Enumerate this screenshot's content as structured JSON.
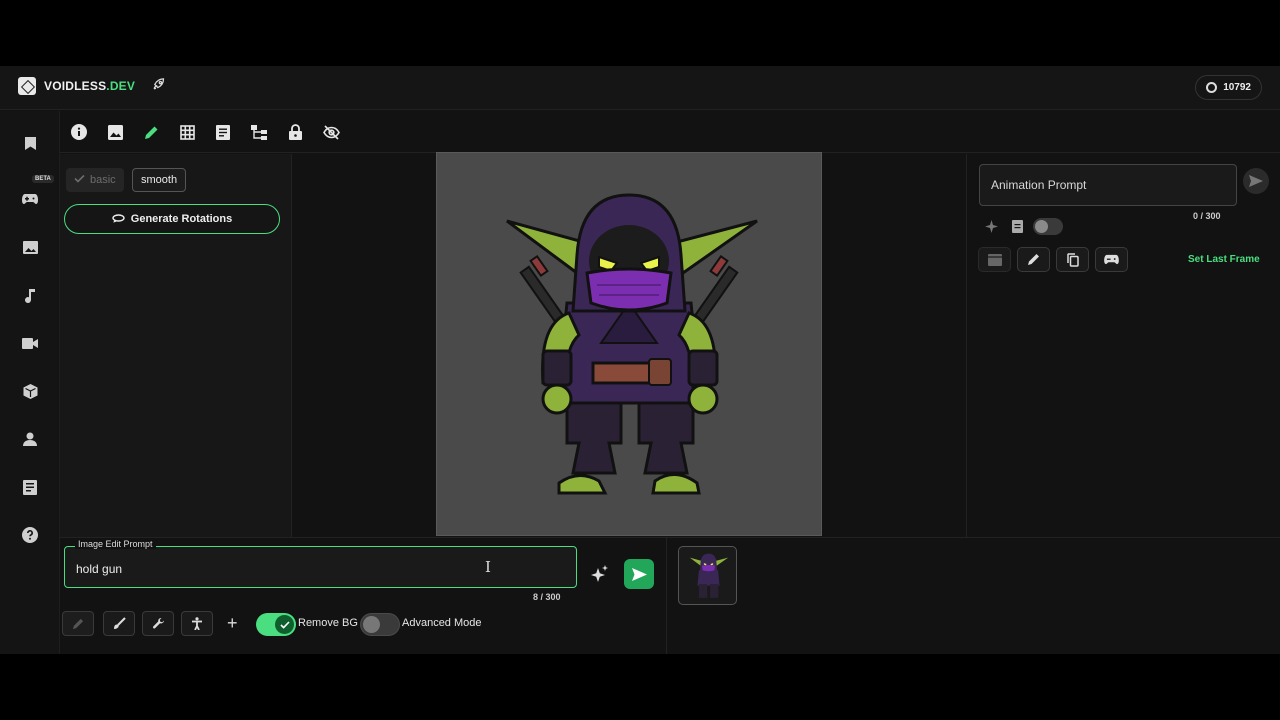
{
  "header": {
    "brand_main": "VOIDLESS",
    "brand_suffix": ".DEV",
    "credits": "10792"
  },
  "sidebar": {
    "beta_badge": "BETA",
    "items": [
      {
        "icon": "bookmark-icon"
      },
      {
        "icon": "gamepad-icon"
      },
      {
        "icon": "image-icon"
      },
      {
        "icon": "music-icon"
      },
      {
        "icon": "video-icon"
      },
      {
        "icon": "cube-icon"
      },
      {
        "icon": "user-icon"
      },
      {
        "icon": "document-icon"
      },
      {
        "icon": "help-icon"
      }
    ]
  },
  "toolbar": {
    "tools": [
      "info-icon",
      "image-icon",
      "pencil-icon",
      "grid-icon",
      "list-icon",
      "hierarchy-icon",
      "lock-icon",
      "eye-off-icon"
    ],
    "active_tool": "pencil-icon"
  },
  "left_panel": {
    "chip_basic": "basic",
    "chip_smooth": "smooth",
    "generate_rotations": "Generate Rotations"
  },
  "right_panel": {
    "animation_placeholder": "Animation Prompt",
    "counter": "0 / 300",
    "set_last_frame": "Set Last Frame"
  },
  "bottom": {
    "edit_legend": "Image Edit Prompt",
    "edit_value": "hold gun",
    "counter": "8 / 300",
    "remove_bg_label": "Remove BG",
    "remove_bg_on": true,
    "advanced_mode_label": "Advanced Mode",
    "advanced_mode_on": false
  },
  "colors": {
    "accent": "#4ade80",
    "send_button": "#22a75a",
    "canvas_bg": "#4a4a4a",
    "character_hood": "#3b2756",
    "character_skin": "#8fb33a",
    "character_mask": "#7b2fb0"
  }
}
